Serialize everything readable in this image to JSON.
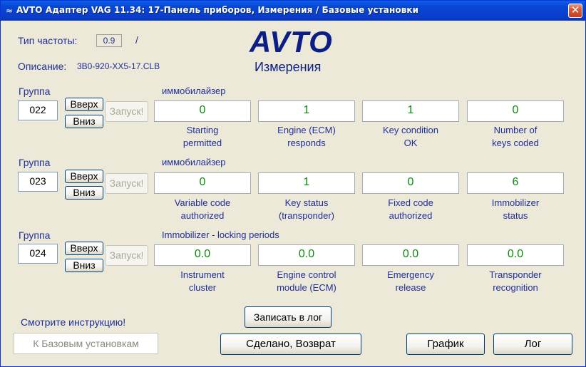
{
  "window": {
    "title": "AVTO Адаптер VAG 11.34: 17-Панель приборов,  Измерения / Базовые установки",
    "close_glyph": "✕",
    "app_icon_glyph": "≈"
  },
  "header": {
    "freq_label": "Тип частоты:",
    "freq_value": "0.9",
    "freq_slash": "/",
    "desc_label": "Описание:",
    "desc_value": "3B0-920-XX5-17.CLB",
    "logo": "AVTO",
    "logo_sub": "Измерения"
  },
  "groups": [
    {
      "label": "Группа",
      "number": "022",
      "up_label": "Вверх",
      "down_label": "Вниз",
      "run_label": "Запуск!",
      "title": "иммобилайзер",
      "fields": [
        {
          "value": "0",
          "line1": "Starting",
          "line2": "permitted"
        },
        {
          "value": "1",
          "line1": "Engine (ECM)",
          "line2": "responds"
        },
        {
          "value": "1",
          "line1": "Key condition",
          "line2": "OK"
        },
        {
          "value": "0",
          "line1": "Number of",
          "line2": "keys coded"
        }
      ]
    },
    {
      "label": "Группа",
      "number": "023",
      "up_label": "Вверх",
      "down_label": "Вниз",
      "run_label": "Запуск!",
      "title": "иммобилайзер",
      "fields": [
        {
          "value": "0",
          "line1": "Variable code",
          "line2": "authorized"
        },
        {
          "value": "1",
          "line1": "Key status",
          "line2": "(transponder)"
        },
        {
          "value": "0",
          "line1": "Fixed code",
          "line2": "authorized"
        },
        {
          "value": "6",
          "line1": "Immobilizer",
          "line2": "status"
        }
      ]
    },
    {
      "label": "Группа",
      "number": "024",
      "up_label": "Вверх",
      "down_label": "Вниз",
      "run_label": "Запуск!",
      "title": "Immobilizer - locking periods",
      "fields": [
        {
          "value": "0.0",
          "line1": "Instrument",
          "line2": "cluster"
        },
        {
          "value": "0.0",
          "line1": "Engine control",
          "line2": "module (ECM)"
        },
        {
          "value": "0.0",
          "line1": "Emergency",
          "line2": "release"
        },
        {
          "value": "0.0",
          "line1": "Transponder",
          "line2": "recognition"
        }
      ]
    }
  ],
  "footer": {
    "log_write_label": "Записать в лог",
    "hint": "Смотрите инструкцию!",
    "basic_settings_label": "К Базовым установкам",
    "done_label": "Сделано, Возврат",
    "graph_label": "График",
    "log_label": "Лог"
  },
  "colors": {
    "label_blue": "#1f2f9a",
    "logo_blue": "#0b1d86",
    "value_green": "#0a8a0a",
    "title_bar": "#0a46d6"
  }
}
